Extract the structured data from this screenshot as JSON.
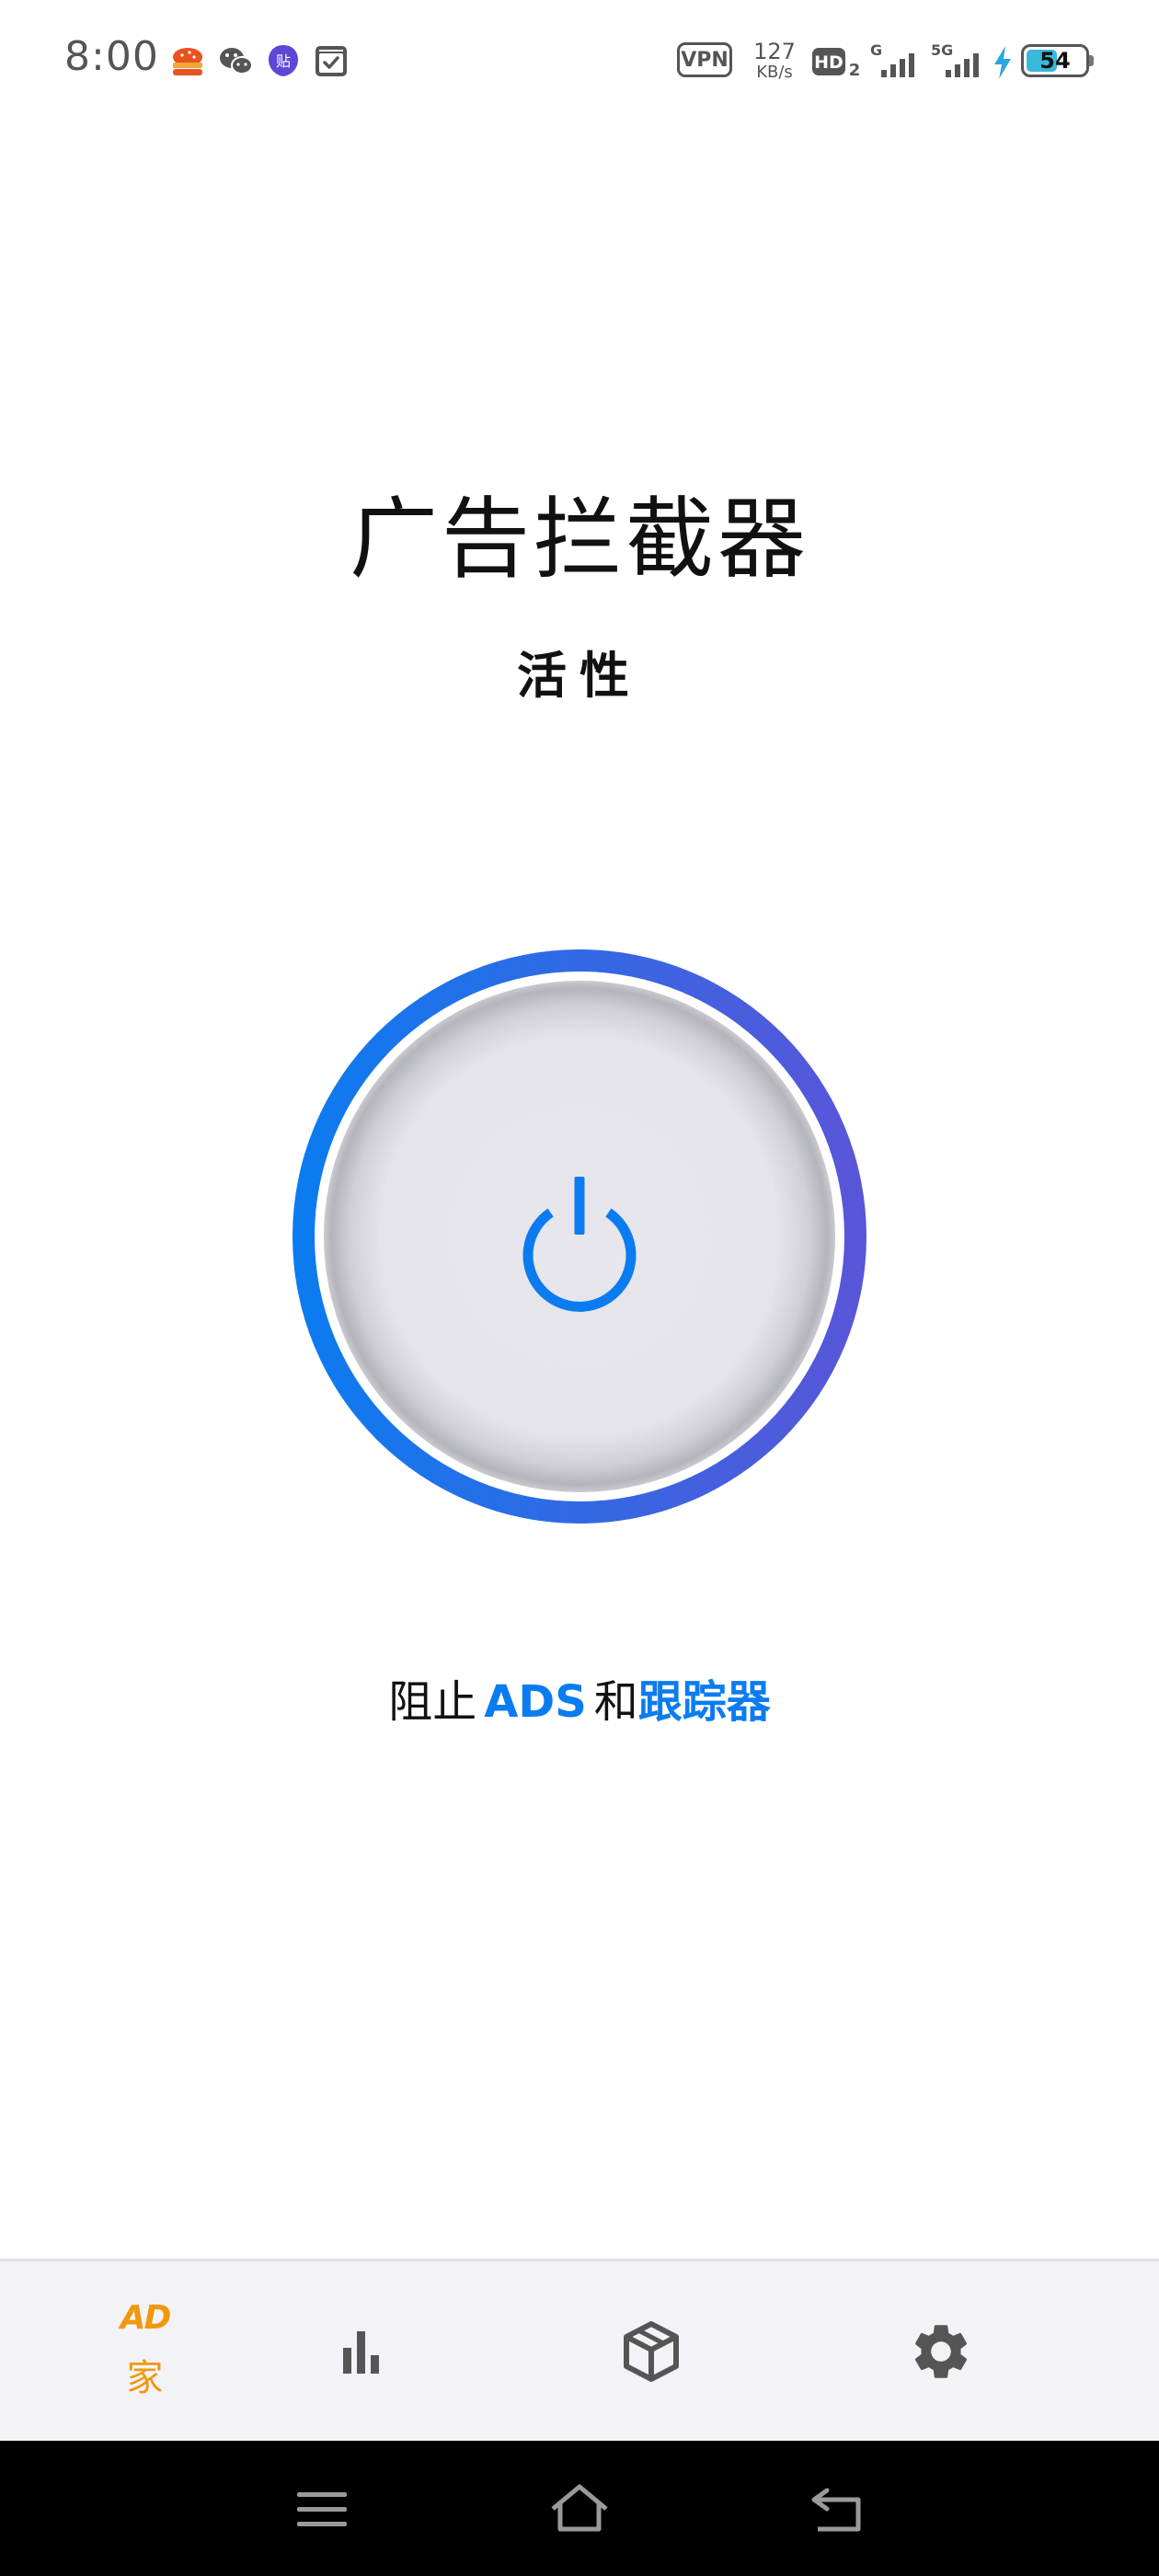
{
  "status_bar": {
    "time": "8:00",
    "vpn_label": "VPN",
    "net_speed_value": "127",
    "net_speed_unit": "KB/s",
    "hd_label": "HD",
    "hd_sub": "2",
    "sim1_label": "G",
    "sim2_label": "5G",
    "battery_level": "54",
    "battery_fraction": 0.54,
    "app_icons": [
      "burger-app-icon",
      "wechat-icon",
      "tie-app-icon",
      "calendar-check-icon"
    ]
  },
  "header": {
    "title": "广告拦截器",
    "status": "活性"
  },
  "power_button": {
    "icon": "power-icon",
    "ring_gradient": [
      "#0a7cf0",
      "#5a55d8"
    ],
    "icon_color": "#0a7cf0"
  },
  "tagline": {
    "prefix": "阻止",
    "ads": "ADS",
    "middle": "和",
    "trackers": "跟踪器"
  },
  "bottom_nav": {
    "items": [
      {
        "icon": "ad-logo-icon",
        "logo_text": "AD",
        "label": "家",
        "active": true
      },
      {
        "icon": "bar-chart-icon",
        "label": "",
        "active": false
      },
      {
        "icon": "package-box-icon",
        "label": "",
        "active": false
      },
      {
        "icon": "gear-icon",
        "label": "",
        "active": false
      }
    ],
    "active_color": "#f0990d",
    "inactive_color": "#555555"
  },
  "system_nav": {
    "buttons": [
      "menu-icon",
      "home-icon",
      "back-icon"
    ]
  }
}
